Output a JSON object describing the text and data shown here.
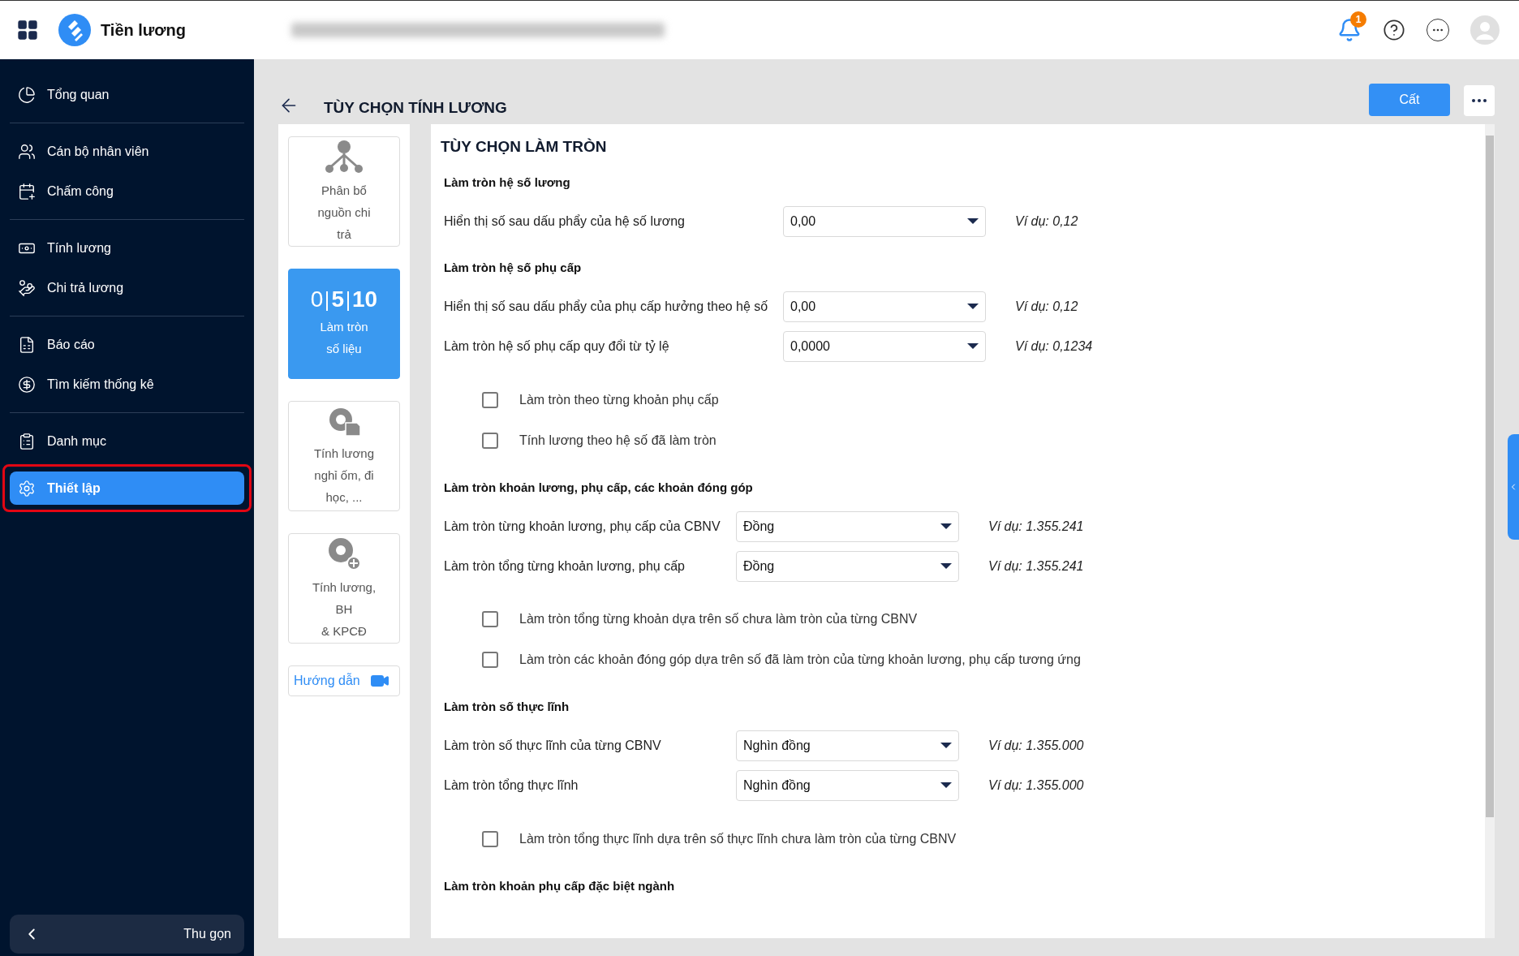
{
  "header": {
    "app_name": "Tiền lương",
    "notification_count": "1"
  },
  "sidebar": {
    "groups": [
      [
        {
          "label": "Tổng quan",
          "selected": false,
          "highlighted": false
        }
      ],
      [
        {
          "label": "Cán bộ nhân viên",
          "selected": false,
          "highlighted": false
        },
        {
          "label": "Chấm công",
          "selected": false,
          "highlighted": false
        }
      ],
      [
        {
          "label": "Tính lương",
          "selected": false,
          "highlighted": false
        },
        {
          "label": "Chi trả lương",
          "selected": false,
          "highlighted": false
        }
      ],
      [
        {
          "label": "Báo cáo",
          "selected": false,
          "highlighted": false
        },
        {
          "label": "Tìm kiếm thống kê",
          "selected": false,
          "highlighted": false
        }
      ],
      [
        {
          "label": "Danh mục",
          "selected": false,
          "highlighted": false
        },
        {
          "label": "Thiết lập",
          "selected": true,
          "highlighted": true
        }
      ]
    ],
    "collapse_label": "Thu gọn"
  },
  "page": {
    "title": "TÙY CHỌN TÍNH LƯƠNG",
    "save_button": "Cất"
  },
  "option_cards": [
    {
      "kind": "icon",
      "lines": [
        "Phân bổ",
        "nguồn chi",
        "trả"
      ],
      "selected": false
    },
    {
      "kind": "digits",
      "digits": [
        "0",
        "5",
        "10"
      ],
      "lines": [
        "Làm tròn",
        "số liệu"
      ],
      "selected": true
    },
    {
      "kind": "icon",
      "lines": [
        "Tính lương",
        "nghỉ ốm, đi",
        "học, ..."
      ],
      "selected": false
    },
    {
      "kind": "icon",
      "lines": [
        "Tính lương,",
        "BH",
        "& KPCĐ"
      ],
      "selected": false
    }
  ],
  "guide_link": "Hướng dẫn",
  "panel": {
    "title": "TÙY CHỌN LÀM TRÒN",
    "sections": [
      {
        "title": "Làm tròn hệ số lương",
        "rows": [
          {
            "kind": "select",
            "label": "Hiển thị số sau dấu phẩy của hệ số lương",
            "value": "0,00",
            "example": "Ví dụ: 0,12"
          }
        ]
      },
      {
        "title": "Làm tròn hệ số phụ cấp",
        "rows": [
          {
            "kind": "select",
            "label": "Hiển thị số sau dấu phẩy của phụ cấp hưởng theo hệ số",
            "value": "0,00",
            "example": "Ví dụ: 0,12"
          },
          {
            "kind": "select",
            "label": "Làm tròn hệ số phụ cấp quy đổi từ tỷ lệ",
            "value": "0,0000",
            "example": "Ví dụ: 0,1234"
          },
          {
            "kind": "checkbox",
            "label": "Làm tròn theo từng khoản phụ cấp",
            "checked": false
          },
          {
            "kind": "checkbox",
            "label": "Tính lương theo hệ số đã làm tròn",
            "checked": false
          }
        ]
      },
      {
        "title": "Làm tròn khoản lương, phụ cấp, các khoản đóng góp",
        "rows": [
          {
            "kind": "select",
            "label": "Làm tròn từng khoản lương, phụ cấp của CBNV",
            "value": "Đồng",
            "example": "Ví dụ: 1.355.241"
          },
          {
            "kind": "select",
            "label": "Làm tròn tổng từng khoản lương, phụ cấp",
            "value": "Đồng",
            "example": "Ví dụ: 1.355.241"
          },
          {
            "kind": "checkbox",
            "label": "Làm tròn tổng từng khoản dựa trên số chưa làm tròn của từng CBNV",
            "checked": false
          },
          {
            "kind": "checkbox",
            "label": "Làm tròn các khoản đóng góp dựa trên số đã làm tròn của từng khoản lương, phụ cấp tương ứng",
            "checked": false
          }
        ]
      },
      {
        "title": "Làm tròn số thực lĩnh",
        "rows": [
          {
            "kind": "select",
            "label": "Làm tròn số thực lĩnh của từng CBNV",
            "value": "Nghìn đồng",
            "example": "Ví dụ: 1.355.000"
          },
          {
            "kind": "select",
            "label": "Làm tròn tổng thực lĩnh",
            "value": "Nghìn đồng",
            "example": "Ví dụ: 1.355.000"
          },
          {
            "kind": "checkbox",
            "label": "Làm tròn tổng thực lĩnh dựa trên số thực lĩnh chưa làm tròn của từng CBNV",
            "checked": false
          }
        ]
      },
      {
        "title": "Làm tròn khoản phụ cấp đặc biệt ngành"
      }
    ]
  }
}
